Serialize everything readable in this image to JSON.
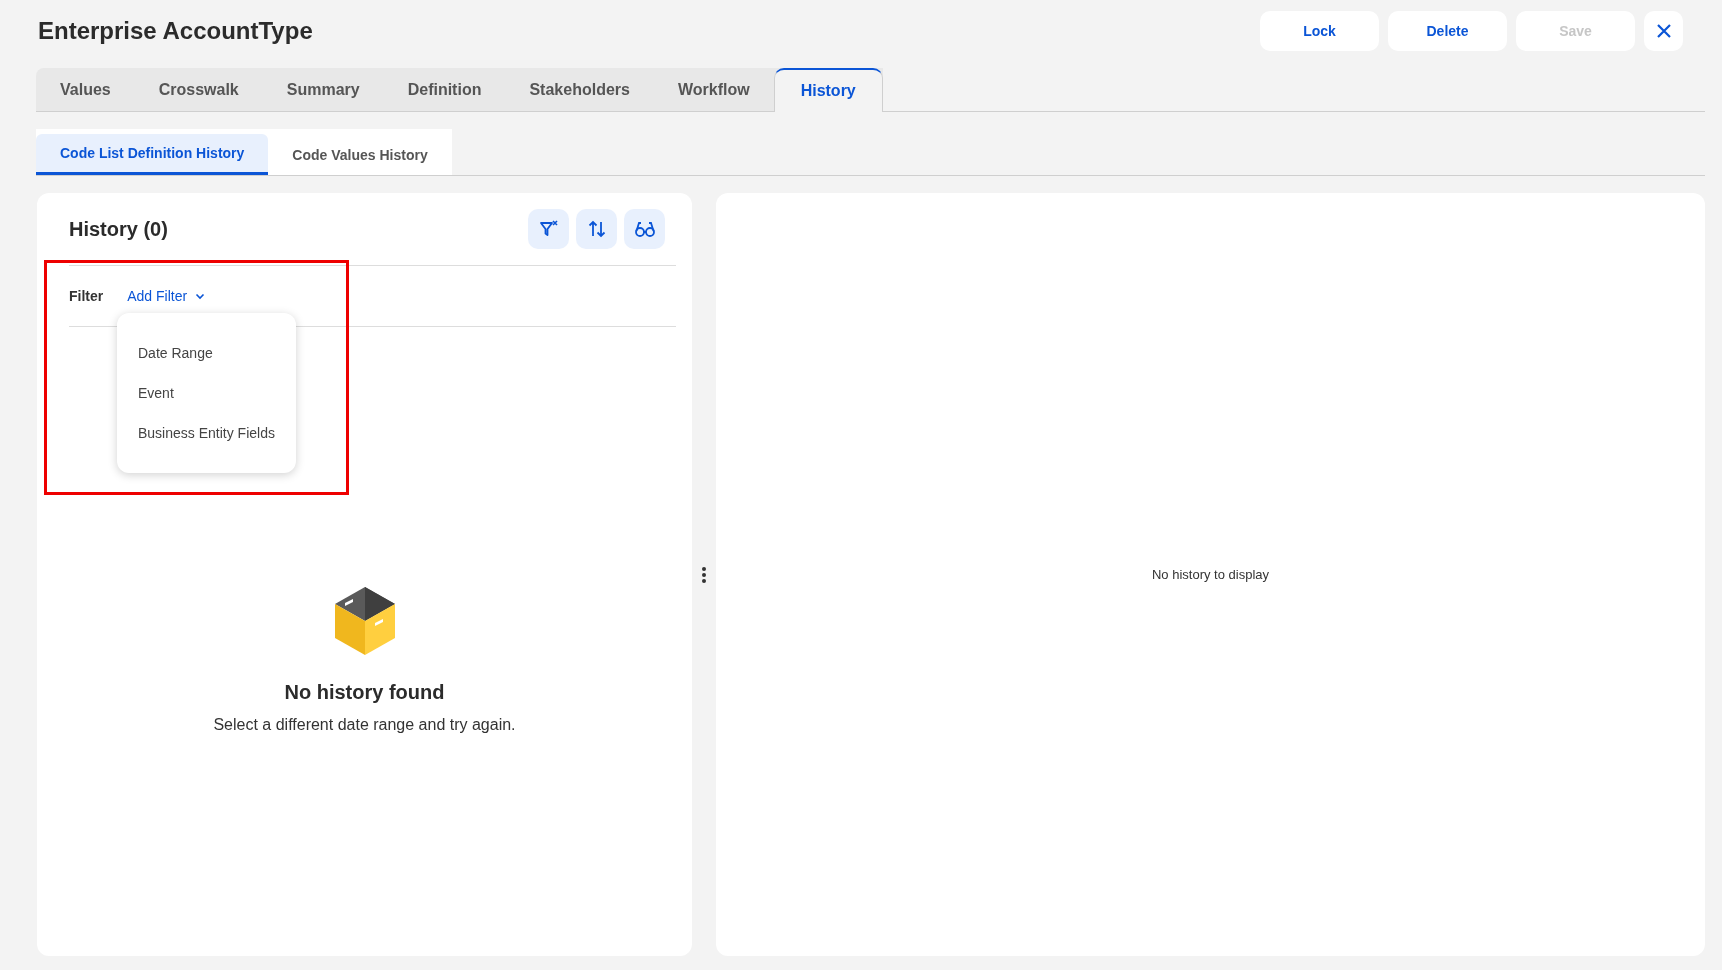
{
  "page": {
    "title": "Enterprise AccountType"
  },
  "actions": [
    {
      "label": "Lock",
      "disabled": false
    },
    {
      "label": "Delete",
      "disabled": false
    },
    {
      "label": "Save",
      "disabled": true
    }
  ],
  "tabs": [
    {
      "label": "Values",
      "selected": false
    },
    {
      "label": "Crosswalk",
      "selected": false
    },
    {
      "label": "Summary",
      "selected": false
    },
    {
      "label": "Definition",
      "selected": false
    },
    {
      "label": "Stakeholders",
      "selected": false
    },
    {
      "label": "Workflow",
      "selected": false
    },
    {
      "label": "History",
      "selected": true
    }
  ],
  "subtabs": [
    {
      "label": "Code List Definition History",
      "selected": true
    },
    {
      "label": "Code Values History",
      "selected": false
    }
  ],
  "history_panel": {
    "title": "History (0)",
    "filter_label": "Filter",
    "add_filter": "Add Filter",
    "filter_menu": [
      "Date Range",
      "Event",
      "Business Entity Fields"
    ],
    "empty_title": "No history found",
    "empty_text": "Select a different date range and try again."
  },
  "detail_panel": {
    "empty_text": "No history to display"
  }
}
